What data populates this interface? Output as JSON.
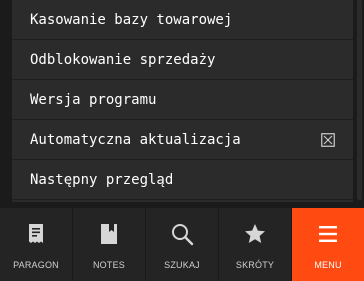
{
  "menu": {
    "items": [
      {
        "label": "Kasowanie bazy towarowej",
        "checkbox": false
      },
      {
        "label": "Odblokowanie sprzedaży",
        "checkbox": false
      },
      {
        "label": "Wersja programu",
        "checkbox": false
      },
      {
        "label": "Automatyczna aktualizacja",
        "checkbox": true,
        "checked": false
      },
      {
        "label": "Następny przegląd",
        "checkbox": false
      }
    ]
  },
  "nav": {
    "items": [
      {
        "label": "PARAGON",
        "icon": "receipt-icon",
        "active": false
      },
      {
        "label": "NOTES",
        "icon": "notes-icon",
        "active": false
      },
      {
        "label": "SZUKAJ",
        "icon": "search-icon",
        "active": false
      },
      {
        "label": "SKRÓTY",
        "icon": "star-icon",
        "active": false
      },
      {
        "label": "MENU",
        "icon": "menu-icon",
        "active": true
      }
    ]
  },
  "colors": {
    "background": "#1b1b1b",
    "item_background": "#2b2b2b",
    "nav_background": "#242424",
    "accent": "#ff4a12",
    "text": "#ffffff"
  }
}
